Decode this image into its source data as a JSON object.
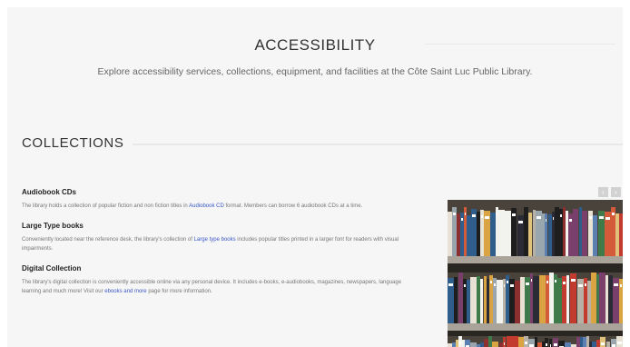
{
  "hero": {
    "title": "ACCESSIBILITY",
    "subtitle": "Explore accessibility services, collections, equipment, and facilities at the Côte Saint Luc Public Library."
  },
  "collections": {
    "heading": "COLLECTIONS",
    "items": [
      {
        "title": "Audiobook CDs",
        "text_before": "The library holds a collection of popular fiction and non fiction titles in ",
        "link": "Audiobook CD",
        "text_after": " format. Members can borrow 6 audiobook CDs at a time."
      },
      {
        "title": "Large Type books",
        "text_before": "Conveniently located near the reference desk, the library's collection of ",
        "link": "Large type books",
        "text_after": " includes popular titles printed in a larger font for readers with visual impairments."
      },
      {
        "title": "Digital Collection",
        "text_before": "The library's digital collection is conveniently accessible online via any personal device. It includes e-books, e-audiobooks, magazines, newspapers, language learning and much more! Visit our ",
        "link": "ebooks and more",
        "text_after": " page for more information."
      }
    ]
  },
  "carousel": {
    "prev_glyph": "‹",
    "next_glyph": "›",
    "image_icon": "bookshelf-photo-icon"
  },
  "colors": {
    "link": "#3a58c8",
    "background": "#f6f6f6"
  }
}
